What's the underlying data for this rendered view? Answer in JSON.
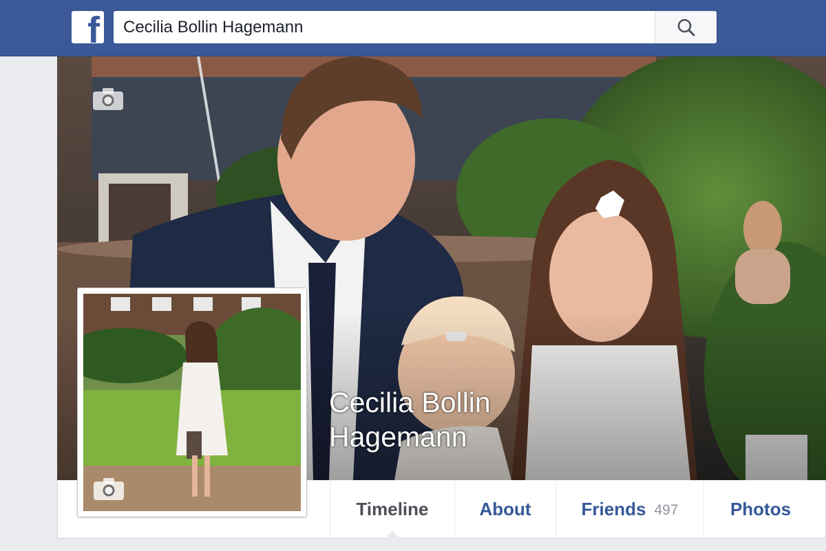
{
  "header": {
    "logo_letter": "f",
    "search_value": "Cecilia Bollin Hagemann",
    "brand_color": "#3b5998"
  },
  "profile": {
    "name_line1": "Cecilia Bollin",
    "name_line2": "Hagemann"
  },
  "tabs": [
    {
      "label": "Timeline",
      "active": true
    },
    {
      "label": "About"
    },
    {
      "label": "Friends",
      "count": "497"
    },
    {
      "label": "Photos"
    }
  ],
  "icons": {
    "cover_camera": "camera-icon",
    "profile_camera": "camera-icon",
    "search": "search-icon"
  }
}
